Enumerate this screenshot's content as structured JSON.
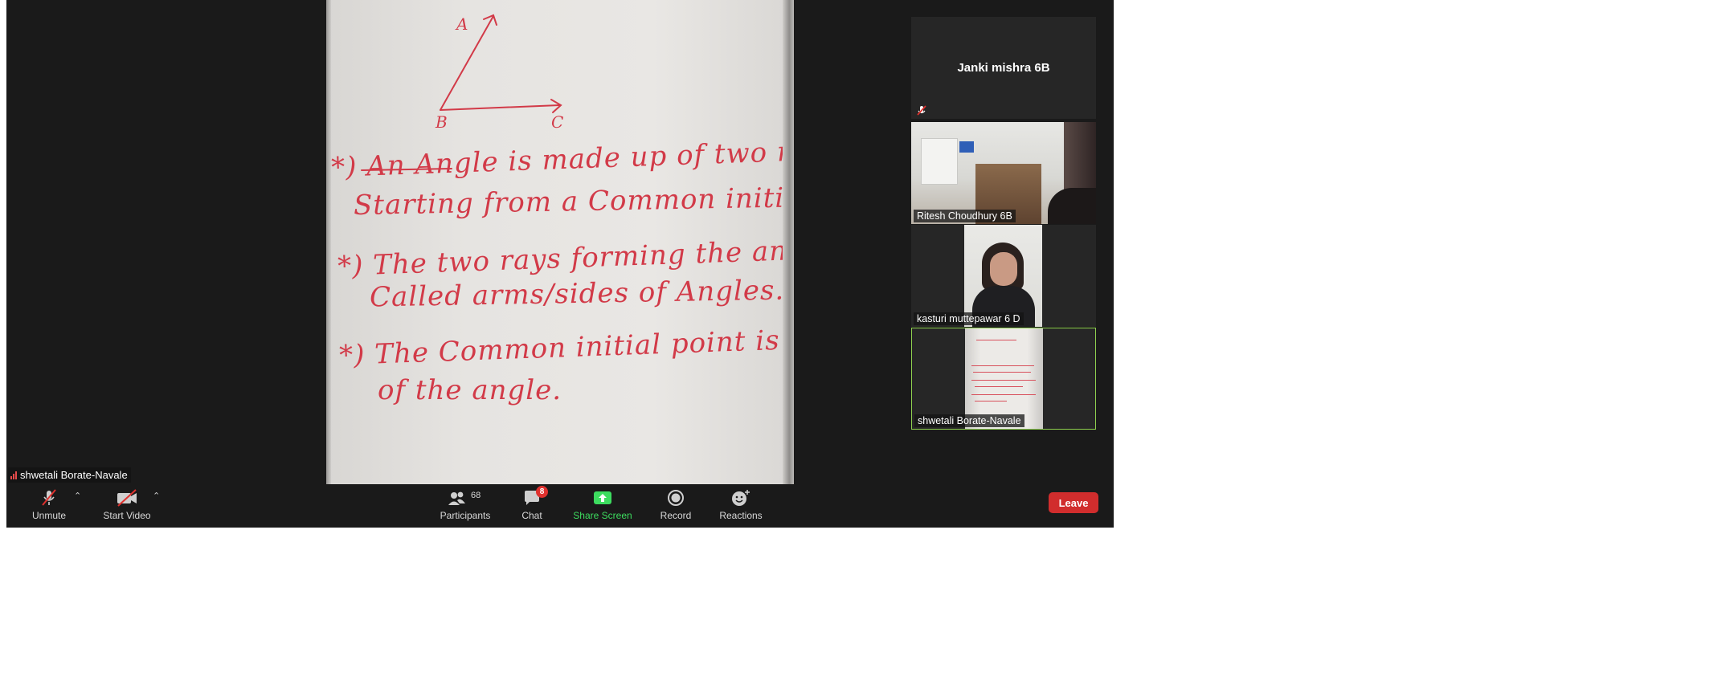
{
  "speaker": {
    "name": "shwetali Borate-Navale"
  },
  "whiteboard": {
    "vertex_labels": {
      "a": "A",
      "b": "B",
      "c": "C"
    },
    "lines": [
      "*) An Angle is made up of two rays",
      "Starting from a Common initial point.",
      "*) The two rays forming the angle are",
      "Called arms/sides of Angles.",
      "*) The Common initial point is the Vertex",
      "of the angle."
    ]
  },
  "gallery": {
    "tiles": [
      {
        "name": "Janki mishra 6B",
        "muted": true
      },
      {
        "name": "Ritesh Choudhury 6B"
      },
      {
        "name": "kasturi muttepawar 6 D"
      },
      {
        "name": "shwetali Borate-Navale",
        "active_speaker": true
      }
    ]
  },
  "toolbar": {
    "unmute_label": "Unmute",
    "start_video_label": "Start Video",
    "participants_label": "Participants",
    "participants_count": "68",
    "chat_label": "Chat",
    "chat_badge": "8",
    "share_screen_label": "Share Screen",
    "record_label": "Record",
    "reactions_label": "Reactions",
    "leave_label": "Leave"
  },
  "colors": {
    "background": "#1a1a1a",
    "share_green": "#3ddc5f",
    "leave_red": "#d12d2d",
    "active_border": "#8fd14f",
    "ink_red": "#d23a48"
  }
}
